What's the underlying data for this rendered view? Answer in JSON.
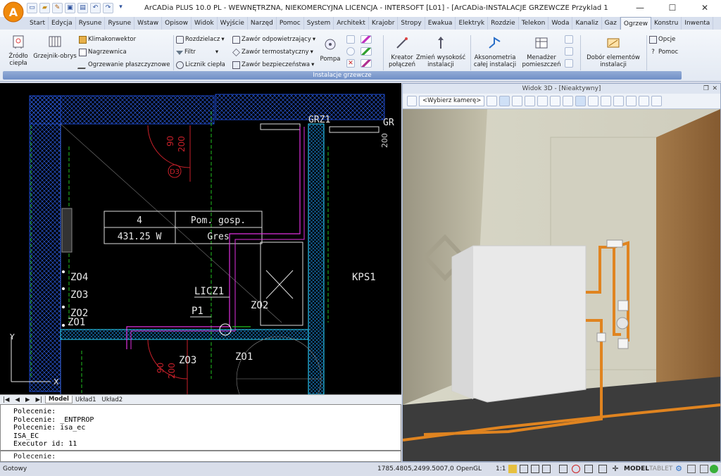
{
  "app": {
    "title": "ArCADia PLUS 10.0 PL - WEWNĘTRZNA, NIEKOMERCYJNA LICENCJA - INTERSOFT [L01] - [ArCADia-INSTALACJE GRZEWCZE Przyklad 1]",
    "logo_text": "A"
  },
  "window_controls": {
    "minimize": "—",
    "maximize": "☐",
    "close": "✕"
  },
  "tabs": [
    "Start",
    "Edycja",
    "Rysune",
    "Rysune",
    "Wstaw",
    "Opisow",
    "Widok",
    "Wyjście",
    "Narzęd",
    "Pomoc",
    "System",
    "Architekt",
    "Krajobr",
    "Stropy",
    "Ewakua",
    "Elektryk",
    "Rozdzie",
    "Telekon",
    "Woda",
    "Kanaliz",
    "Gaz",
    "Ogrzew",
    "Konstru",
    "Inwenta"
  ],
  "active_tab_index": 21,
  "ribbon": {
    "zrodlo": "Źródło\nciepła",
    "grzejnik": "Grzejnik-obrys",
    "klimakonwektor": "Klimakonwektor",
    "nagrzewnica": "Nagrzewnica",
    "ogrzewanie": "Ogrzewanie płaszczyznowe",
    "rozdzielacz": "Rozdzielacz",
    "filtr": "Filtr",
    "licznik": "Licznik ciepła",
    "zawor_odp": "Zawór odpowietrzający",
    "zawor_term": "Zawór termostatyczny",
    "zawor_bezp": "Zawór bezpieczeństwa",
    "pompa": "Pompa",
    "kreator": "Kreator\npołączeń",
    "zmien": "Zmień wysokość\ninstalacji",
    "aksonometria": "Aksonometria\ncałej instalacji",
    "menadzer": "Menadżer\npomieszczeń",
    "dobor": "Dobór elementów\ninstalacji",
    "opcje": "Opcje",
    "pomoc": "Pomoc",
    "group_label": "Instalacje grzewcze"
  },
  "cad": {
    "room_number": "4",
    "room_name": "Pom. gosp.",
    "room_power": "431.25  W",
    "room_floor": "Gres",
    "grz1": "GRZ1",
    "grz_right": "GR",
    "kps1": "KPS1",
    "licz1": "LICZ1",
    "p1": "P1",
    "zo2_a": "ZO2",
    "zo2_b": "ZO2",
    "zo3": "ZO3",
    "zo4": "ZO4",
    "zo1_a": "ZO1",
    "zo1_b": "ZO1",
    "zo3_b": "ZO3",
    "dim_90_top": "90",
    "dim_200_top": "200",
    "dim_90_bot": "90",
    "dim_200_bot": "200",
    "dim_right": "200",
    "door_label": "D3",
    "axis_y": "Y",
    "axis_x": "X"
  },
  "layout_tabs": [
    "Model",
    "Układ1",
    "Układ2"
  ],
  "command": {
    "lines": [
      "Polecenie:",
      "Polecenie: _ENTPROP",
      "Polecenie: isa_ec",
      "ISA_EC",
      "Executor id: 11"
    ],
    "prompt": "Polecenie:"
  },
  "view3d": {
    "title": "Widok 3D - [Nieaktywny]",
    "camera": "<Wybierz kamerę>"
  },
  "status": {
    "ready": "Gotowy",
    "coords": "1785.4805,2499.5007,0",
    "renderer": "OpenGL",
    "scale": "1:1",
    "model": "MODEL",
    "tablet": "TABLET"
  },
  "colors": {
    "wall": "#1a46c8",
    "cyan_pipe": "#2ad6ff",
    "magenta": "#e030e0",
    "green": "#22c020",
    "red": "#c8202a"
  }
}
